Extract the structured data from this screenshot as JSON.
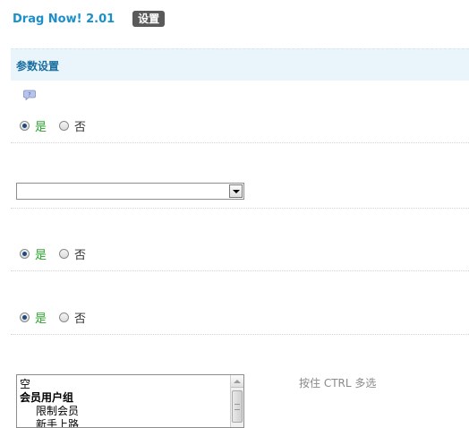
{
  "header": {
    "app_title": "Drag Now! 2.01",
    "badge": "设置"
  },
  "section": {
    "title": "参数设置"
  },
  "groups": [
    {
      "yes_label": "是",
      "no_label": "否",
      "selected": "yes"
    },
    {
      "yes_label": "是",
      "no_label": "否",
      "selected": "yes"
    },
    {
      "yes_label": "是",
      "no_label": "否",
      "selected": "yes"
    }
  ],
  "select": {
    "value": ""
  },
  "listbox": {
    "options": [
      {
        "label": "空",
        "type": "normal"
      },
      {
        "label": "会员用户组",
        "type": "group"
      },
      {
        "label": "限制会员",
        "type": "indent"
      },
      {
        "label": "新手上路",
        "type": "indent"
      }
    ],
    "hint": "按住 CTRL 多选"
  },
  "colors": {
    "accent": "#1a8fc9",
    "yes": "#2aa52a",
    "header_bg": "#eaf4fb"
  },
  "icons": {
    "help": "help-bubble-icon",
    "select_arrow": "chevron-down-icon",
    "scroll_up": "scroll-up-arrow-icon"
  }
}
